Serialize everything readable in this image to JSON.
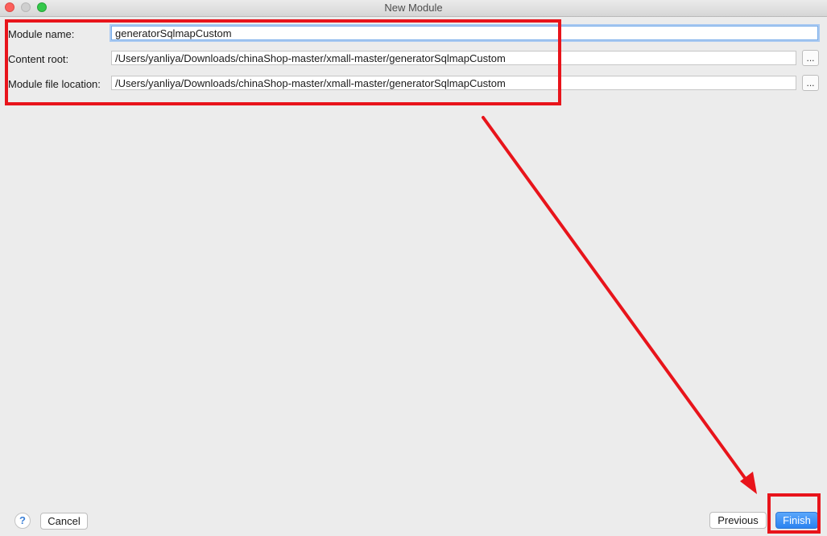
{
  "window": {
    "title": "New Module"
  },
  "form": {
    "module_name": {
      "label": "Module name:",
      "value": "generatorSqlmapCustom"
    },
    "content_root": {
      "label": "Content root:",
      "value": "/Users/yanliya/Downloads/chinaShop-master/xmall-master/generatorSqlmapCustom",
      "browse_label": "..."
    },
    "module_file_location": {
      "label": "Module file location:",
      "value": "/Users/yanliya/Downloads/chinaShop-master/xmall-master/generatorSqlmapCustom",
      "browse_label": "..."
    }
  },
  "footer": {
    "help_label": "?",
    "cancel_label": "Cancel",
    "previous_label": "Previous",
    "finish_label": "Finish"
  },
  "colors": {
    "annotation": "#e8141b",
    "primary_button": "#2a82f0",
    "focus_ring": "#a9c9f1"
  }
}
